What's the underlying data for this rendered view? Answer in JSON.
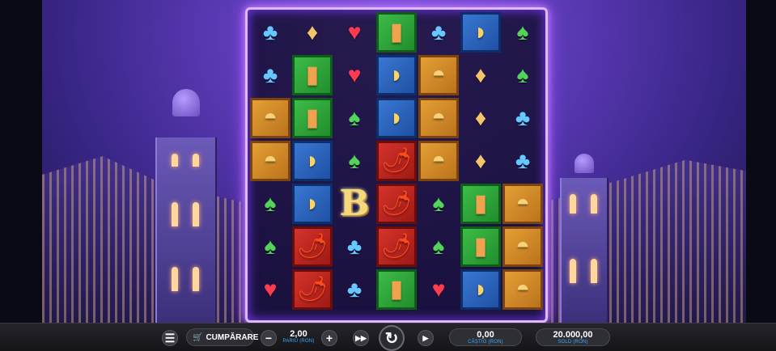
{
  "reels_grid": [
    [
      {
        "kind": "suit",
        "icon": "club-icon",
        "glyph": "♣",
        "frame": ""
      },
      {
        "kind": "suit",
        "icon": "club-icon",
        "glyph": "♣",
        "frame": ""
      },
      {
        "kind": "premium",
        "icon": "sombrero-icon",
        "glyph": "◓",
        "frame": "orange"
      },
      {
        "kind": "premium",
        "icon": "sombrero-icon",
        "glyph": "◓",
        "frame": "orange"
      },
      {
        "kind": "suit",
        "icon": "spade-icon",
        "glyph": "♠",
        "frame": ""
      },
      {
        "kind": "suit",
        "icon": "spade-icon",
        "glyph": "♠",
        "frame": ""
      },
      {
        "kind": "suit",
        "icon": "heart-icon",
        "glyph": "♥",
        "frame": ""
      }
    ],
    [
      {
        "kind": "suit",
        "icon": "diamond-icon",
        "glyph": "♦",
        "frame": ""
      },
      {
        "kind": "premium",
        "icon": "tequila-bottle-icon",
        "glyph": "▮",
        "frame": "green"
      },
      {
        "kind": "premium",
        "icon": "tequila-bottle-icon",
        "glyph": "▮",
        "frame": "green"
      },
      {
        "kind": "premium",
        "icon": "taco-icon",
        "glyph": "◗",
        "frame": "blue"
      },
      {
        "kind": "premium",
        "icon": "taco-icon",
        "glyph": "◗",
        "frame": "blue"
      },
      {
        "kind": "premium",
        "icon": "chili-pepper-icon",
        "glyph": "🌶",
        "frame": "red"
      },
      {
        "kind": "premium",
        "icon": "chili-pepper-icon",
        "glyph": "🌶",
        "frame": "red"
      }
    ],
    [
      {
        "kind": "suit",
        "icon": "heart-icon",
        "glyph": "♥",
        "frame": ""
      },
      {
        "kind": "suit",
        "icon": "heart-icon",
        "glyph": "♥",
        "frame": ""
      },
      {
        "kind": "suit",
        "icon": "spade-icon",
        "glyph": "♠",
        "frame": ""
      },
      {
        "kind": "suit",
        "icon": "spade-icon",
        "glyph": "♠",
        "frame": ""
      },
      {
        "kind": "bonus",
        "icon": "bonus-b-icon",
        "glyph": "B",
        "frame": ""
      },
      {
        "kind": "suit",
        "icon": "club-icon",
        "glyph": "♣",
        "frame": ""
      },
      {
        "kind": "suit",
        "icon": "club-icon",
        "glyph": "♣",
        "frame": ""
      }
    ],
    [
      {
        "kind": "premium",
        "icon": "tequila-bottle-icon",
        "glyph": "▮",
        "frame": "green"
      },
      {
        "kind": "premium",
        "icon": "taco-icon",
        "glyph": "◗",
        "frame": "blue"
      },
      {
        "kind": "premium",
        "icon": "taco-icon",
        "glyph": "◗",
        "frame": "blue"
      },
      {
        "kind": "premium",
        "icon": "chili-pepper-icon",
        "glyph": "🌶",
        "frame": "red"
      },
      {
        "kind": "premium",
        "icon": "chili-pepper-icon",
        "glyph": "🌶",
        "frame": "red"
      },
      {
        "kind": "premium",
        "icon": "chili-pepper-icon",
        "glyph": "🌶",
        "frame": "red"
      },
      {
        "kind": "premium",
        "icon": "tequila-bottle-icon",
        "glyph": "▮",
        "frame": "green"
      }
    ],
    [
      {
        "kind": "suit",
        "icon": "club-icon",
        "glyph": "♣",
        "frame": ""
      },
      {
        "kind": "premium",
        "icon": "sombrero-icon",
        "glyph": "◓",
        "frame": "orange"
      },
      {
        "kind": "premium",
        "icon": "sombrero-icon",
        "glyph": "◓",
        "frame": "orange"
      },
      {
        "kind": "premium",
        "icon": "sombrero-icon",
        "glyph": "◓",
        "frame": "orange"
      },
      {
        "kind": "suit",
        "icon": "spade-icon",
        "glyph": "♠",
        "frame": ""
      },
      {
        "kind": "suit",
        "icon": "spade-icon",
        "glyph": "♠",
        "frame": ""
      },
      {
        "kind": "suit",
        "icon": "heart-icon",
        "glyph": "♥",
        "frame": ""
      }
    ],
    [
      {
        "kind": "premium",
        "icon": "taco-icon",
        "glyph": "◗",
        "frame": "blue"
      },
      {
        "kind": "suit",
        "icon": "diamond-icon",
        "glyph": "♦",
        "frame": ""
      },
      {
        "kind": "suit",
        "icon": "diamond-icon",
        "glyph": "♦",
        "frame": ""
      },
      {
        "kind": "suit",
        "icon": "diamond-icon",
        "glyph": "♦",
        "frame": ""
      },
      {
        "kind": "premium",
        "icon": "tequila-bottle-icon",
        "glyph": "▮",
        "frame": "green"
      },
      {
        "kind": "premium",
        "icon": "tequila-bottle-icon",
        "glyph": "▮",
        "frame": "green"
      },
      {
        "kind": "premium",
        "icon": "taco-icon",
        "glyph": "◗",
        "frame": "blue"
      }
    ],
    [
      {
        "kind": "suit",
        "icon": "spade-icon",
        "glyph": "♠",
        "frame": ""
      },
      {
        "kind": "suit",
        "icon": "spade-icon",
        "glyph": "♠",
        "frame": ""
      },
      {
        "kind": "suit",
        "icon": "club-icon",
        "glyph": "♣",
        "frame": ""
      },
      {
        "kind": "suit",
        "icon": "club-icon",
        "glyph": "♣",
        "frame": ""
      },
      {
        "kind": "premium",
        "icon": "sombrero-icon",
        "glyph": "◓",
        "frame": "orange"
      },
      {
        "kind": "premium",
        "icon": "sombrero-icon",
        "glyph": "◓",
        "frame": "orange"
      },
      {
        "kind": "premium",
        "icon": "sombrero-icon",
        "glyph": "◓",
        "frame": "orange"
      }
    ]
  ],
  "colors": {
    "reel_glow": "#c98cff",
    "label_blue": "#3fa8ff",
    "bar_bg": "#1c1c20"
  },
  "controls": {
    "menu_icon": "hamburger-icon",
    "buy_icon": "cart-icon",
    "buy_label": "CUMPĂRARE",
    "minus_icon": "minus-icon",
    "plus_icon": "plus-icon",
    "bet_value": "2,00",
    "bet_label": "PARIU (RON)",
    "turbo_icon": "fast-forward-icon",
    "spin_icon": "spin-arrow-icon",
    "autoplay_icon": "play-icon",
    "win_value": "0,00",
    "win_label": "CÂȘTIG (RON)",
    "balance_value": "20.000,00",
    "balance_label": "SOLD (RON)"
  }
}
